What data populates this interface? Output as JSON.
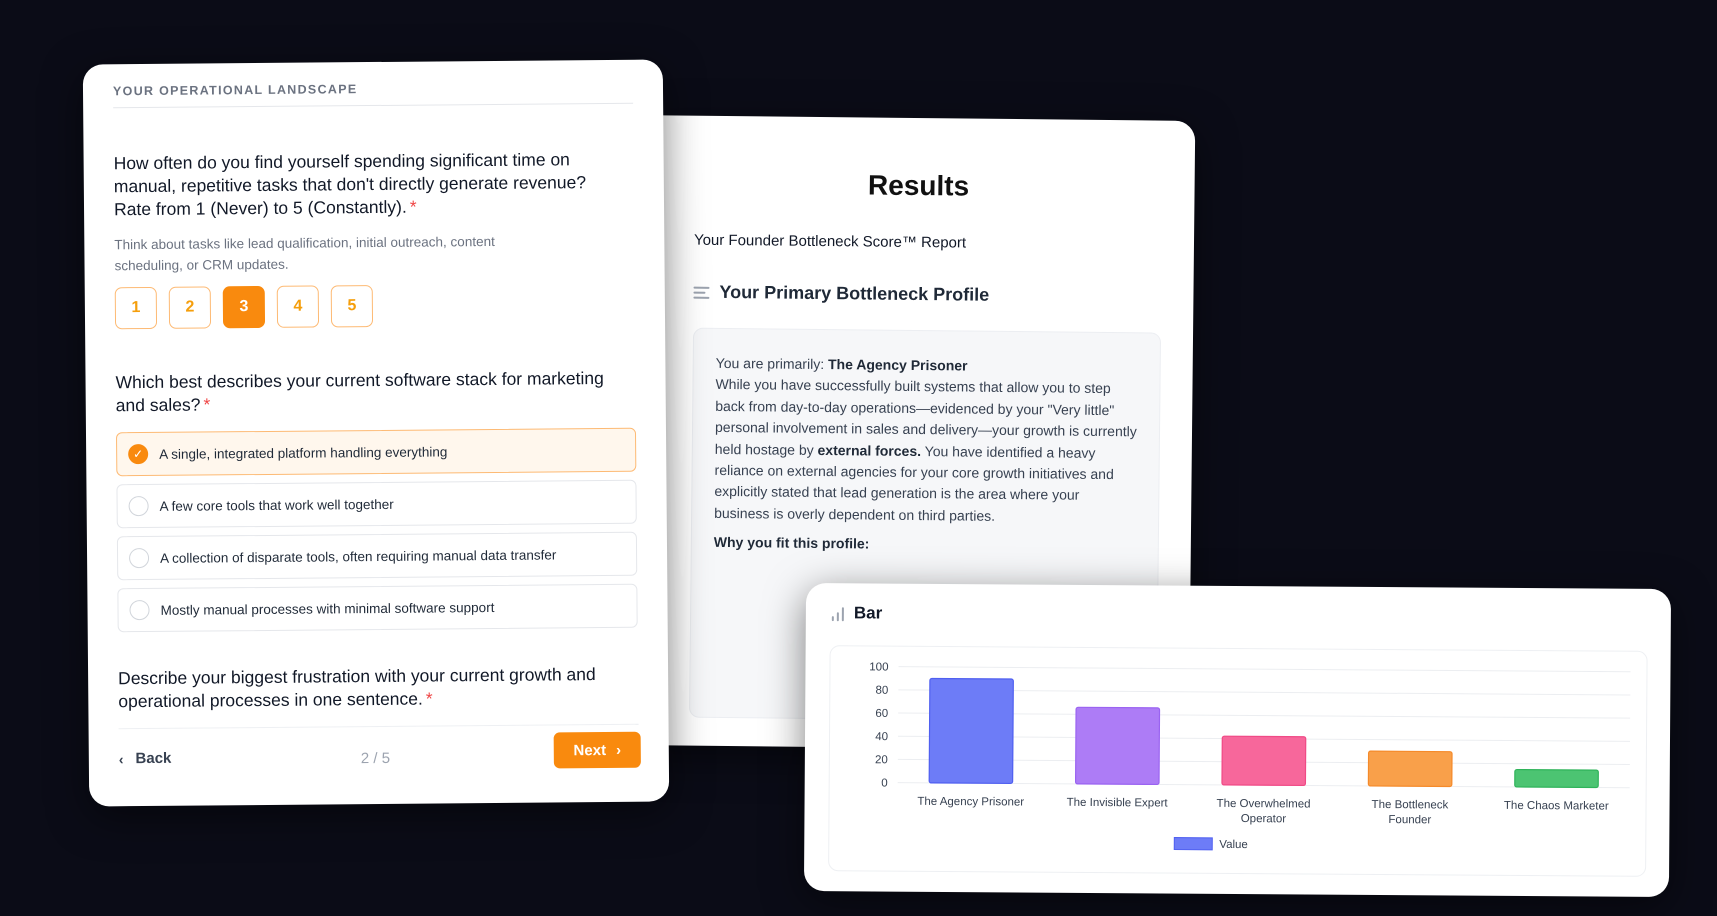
{
  "form": {
    "section_label": "YOUR OPERATIONAL LANDSCAPE",
    "q1": {
      "text": "How often do you find yourself spending significant time on manual, repetitive tasks that don't directly generate revenue? Rate from 1 (Never) to 5 (Constantly).",
      "required_mark": "*",
      "hint": "Think about tasks like lead qualification, initial outreach, content scheduling, or CRM updates.",
      "ratings": [
        "1",
        "2",
        "3",
        "4",
        "5"
      ],
      "selected_rating": "3"
    },
    "q2": {
      "text": "Which best describes your current software stack for marketing and sales?",
      "required_mark": "*",
      "options": [
        "A single, integrated platform handling everything",
        "A few core tools that work well together",
        "A collection of disparate tools, often requiring manual data transfer",
        "Mostly manual processes with minimal software support"
      ],
      "selected_option": 0
    },
    "q3": {
      "text": "Describe your biggest frustration with your current growth and operational processes in one sentence.",
      "required_mark": "*"
    },
    "footer": {
      "back_label": "Back",
      "page_indicator": "2 / 5",
      "next_label": "Next"
    },
    "accent_color": "#f98a0e"
  },
  "results": {
    "title": "Results",
    "subtitle": "Your Founder Bottleneck Score™ Report",
    "profile_heading": "Your Primary Bottleneck Profile",
    "primary_prefix": "You are primarily:",
    "primary_name": "The Agency Prisoner",
    "body_1": "While you have successfully built systems that allow you to step back from day-to-day operations—evidenced by your \"Very little\" personal involvement in sales and delivery—your growth is currently held hostage by",
    "body_bold": "external forces.",
    "body_2": "You have identified a heavy reliance on external agencies for your core growth initiatives and explicitly stated that lead generation is the area where your business is overly dependent on third parties.",
    "why_heading": "Why you fit this profile:"
  },
  "chart_card": {
    "title": "Bar"
  },
  "chart_data": {
    "type": "bar",
    "categories": [
      "The Agency Prisoner",
      "The Invisible Expert",
      "The Overwhelmed Operator",
      "The Bottleneck Founder",
      "The Chaos Marketer"
    ],
    "category_lines": [
      [
        "The Agency Prisoner"
      ],
      [
        "The Invisible Expert"
      ],
      [
        "The Overwhelmed",
        "Operator"
      ],
      [
        "The Bottleneck",
        "Founder"
      ],
      [
        "The Chaos Marketer"
      ]
    ],
    "series": [
      {
        "name": "Value",
        "values": [
          90,
          66,
          42,
          30,
          15
        ]
      }
    ],
    "bar_colors": [
      "#6d7cf7",
      "#ad7cf6",
      "#f7679b",
      "#f9a04a",
      "#4cc472"
    ],
    "bar_strokes": [
      "#4f5ff0",
      "#9a63f1",
      "#f04a86",
      "#f58a2a",
      "#2fb35a"
    ],
    "legend_color": "#6d7cf7",
    "ylim": [
      0,
      100
    ],
    "yticks": [
      "0",
      "20",
      "40",
      "60",
      "80",
      "100"
    ],
    "title": "",
    "xlabel": "",
    "ylabel": "",
    "grid": true,
    "legend_position": "bottom"
  }
}
